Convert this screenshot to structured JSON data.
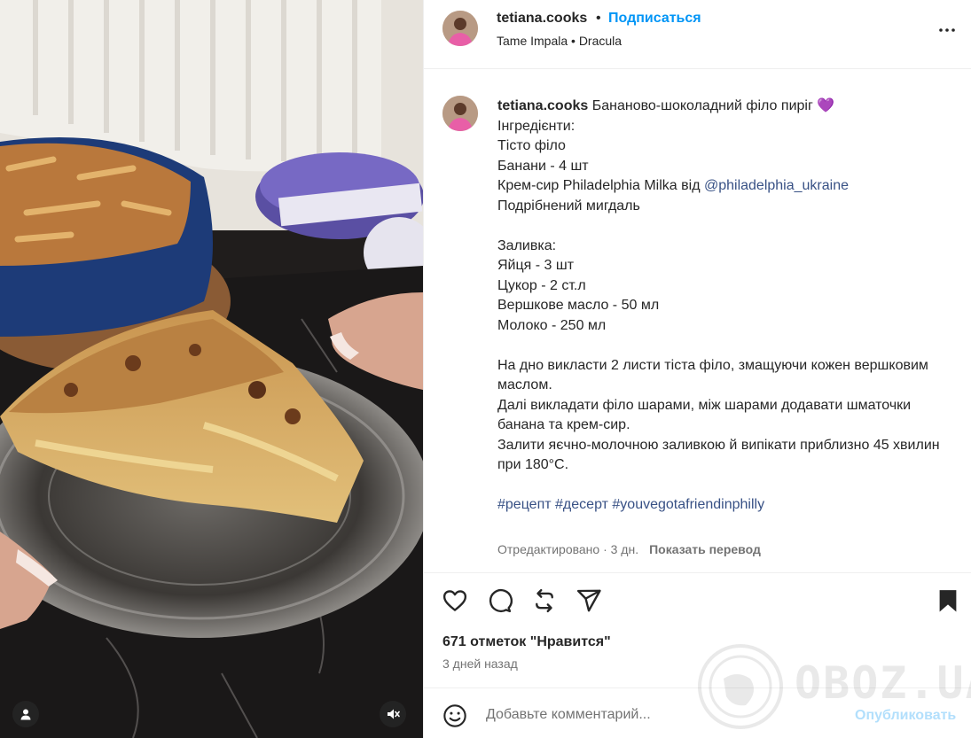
{
  "header": {
    "username": "tetiana.cooks",
    "dot": "•",
    "follow_label": "Подписаться",
    "audio": "Tame Impala • Dracula",
    "more_icon": "more-horizontal-icon"
  },
  "caption": {
    "username": "tetiana.cooks",
    "title": "Бананово-шоколадний філо пиріг",
    "heart": "💜",
    "lines": [
      "",
      "Інгредієнти:",
      "Тісто філо",
      "Банани - 4 шт"
    ],
    "cream_prefix": "Крем-сир Philadelphia Milka від ",
    "mention": "@philadelphia_ukraine",
    "lines2": [
      "Подрібнений мигдаль",
      "",
      "Заливка:",
      "Яйця - 3 шт",
      "Цукор - 2 ст.л",
      "Вершкове масло - 50 мл",
      "Молоко - 250 мл",
      "",
      "На дно викласти 2 листи тіста філо, змащуючи кожен вершковим маслом.",
      "Далі викладати філо шарами, між шарами додавати шматочки банана та крем-сир.",
      "Залити яєчно-молочною заливкою й випікати приблизно 45 хвилин при 180°C.",
      ""
    ],
    "hashtags": [
      "#рецепт",
      "#десерт",
      "#youvegotafriendinphilly"
    ],
    "edited": "Отредактировано · 3 дн.",
    "translate": "Показать перевод"
  },
  "actions": {
    "like_icon": "heart-icon",
    "comment_icon": "comment-icon",
    "repost_icon": "repost-icon",
    "share_icon": "share-icon",
    "save_icon": "bookmark-icon",
    "likes": "671 отметок \"Нравится\"",
    "date": "3 дней назад"
  },
  "comment": {
    "emoji_icon": "emoji-icon",
    "placeholder": "Добавьте комментарий...",
    "publish": "Опубликовать"
  },
  "media": {
    "user_tag_icon": "user-icon",
    "mute_icon": "speaker-muted-icon"
  },
  "watermark": "OBOZ.UA"
}
